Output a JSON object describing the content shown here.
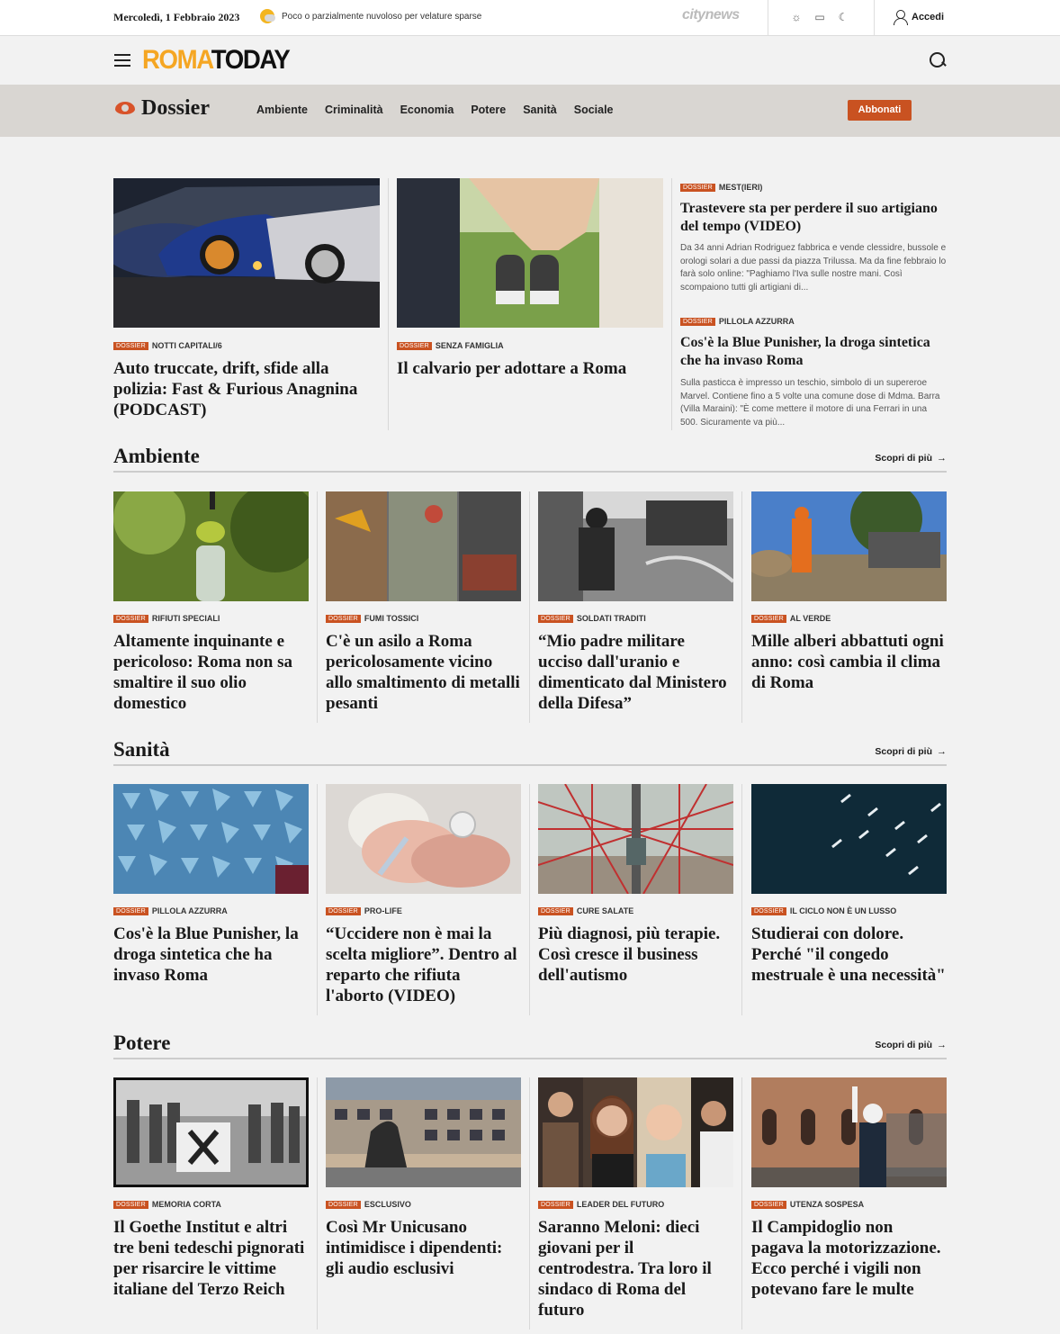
{
  "topbar": {
    "date": "Mercoledì, 1 Febbraio 2023",
    "weather": "Poco o parzialmente nuvoloso per velature sparse",
    "network": "citynews",
    "login": "Accedi"
  },
  "header": {
    "logo_part1": "ROMA",
    "logo_part2": "TODAY"
  },
  "dossier": {
    "brand": "Dossier",
    "nav": [
      "Ambiente",
      "Criminalità",
      "Economia",
      "Potere",
      "Sanità",
      "Sociale"
    ],
    "subscribe": "Abbonati"
  },
  "badge": "DOSSIER",
  "featured": [
    {
      "category": "NOTTI CAPITALI/6",
      "title": "Auto truccate, drift, sfide alla polizia: Fast & Furious Anagnina (PODCAST)"
    },
    {
      "category": "SENZA FAMIGLIA",
      "title": "Il calvario per adottare a Roma"
    },
    {
      "category": "MEST(IERI)",
      "title": "Trastevere sta per perdere il suo artigiano del tempo (VIDEO)",
      "excerpt": "Da 34 anni Adrian Rodriguez fabbrica e vende clessidre, bussole e orologi solari a due passi da piazza Trilussa. Ma da fine febbraio lo farà solo online: \"Paghiamo l'Iva sulle nostre mani. Così scompaiono tutti gli artigiani di..."
    },
    {
      "category": "PILLOLA AZZURRA",
      "title": "Cos'è la Blue Punisher, la droga sintetica che ha invaso Roma",
      "excerpt": "Sulla pasticca è impresso un teschio, simbolo di un supereroe Marvel. Contiene fino a 5 volte una comune dose di Mdma. Barra (Villa Maraini): \"È come mettere il motore di una Ferrari in una 500. Sicuramente va più..."
    }
  ],
  "sections": [
    {
      "title": "Ambiente",
      "more": "Scopri di più",
      "cards": [
        {
          "category": "RIFIUTI SPECIALI",
          "title": "Altamente inquinante e pericoloso: Roma non sa smaltire il suo olio domestico"
        },
        {
          "category": "FUMI TOSSICI",
          "title": "C'è un asilo a Roma pericolosamente vicino allo smaltimento di metalli pesanti"
        },
        {
          "category": "SOLDATI TRADITI",
          "title": "“Mio padre militare ucciso dall'uranio e dimenticato dal Ministero della Difesa”"
        },
        {
          "category": "AL VERDE",
          "title": "Mille alberi abbattuti ogni anno: così cambia il clima di Roma"
        }
      ]
    },
    {
      "title": "Sanità",
      "more": "Scopri di più",
      "cards": [
        {
          "category": "PILLOLA AZZURRA",
          "title": "Cos'è la Blue Punisher, la droga sintetica che ha invaso Roma"
        },
        {
          "category": "PRO-LIFE",
          "title": "“Uccidere non è mai la scelta migliore”. Dentro al reparto che rifiuta l'aborto (VIDEO)"
        },
        {
          "category": "CURE SALATE",
          "title": "Più diagnosi, più terapie. Così cresce il business dell'autismo"
        },
        {
          "category": "IL CICLO NON È UN LUSSO",
          "title": "Studierai con dolore. Perché \"il congedo mestruale è una necessità\""
        }
      ]
    },
    {
      "title": "Potere",
      "more": "Scopri di più",
      "cards": [
        {
          "category": "MEMORIA CORTA",
          "title": "Il Goethe Institut e altri tre beni tedeschi pignorati per risarcire le vittime italiane del Terzo Reich"
        },
        {
          "category": "ESCLUSIVO",
          "title": "Così Mr Unicusano intimidisce i dipendenti: gli audio esclusivi"
        },
        {
          "category": "LEADER DEL FUTURO",
          "title": "Saranno Meloni: dieci giovani per il centrodestra. Tra loro il sindaco di Roma del futuro"
        },
        {
          "category": "UTENZA SOSPESA",
          "title": "Il Campidoglio non pagava la motorizzazione. Ecco perché i vigili non potevano fare le multe"
        }
      ]
    }
  ]
}
